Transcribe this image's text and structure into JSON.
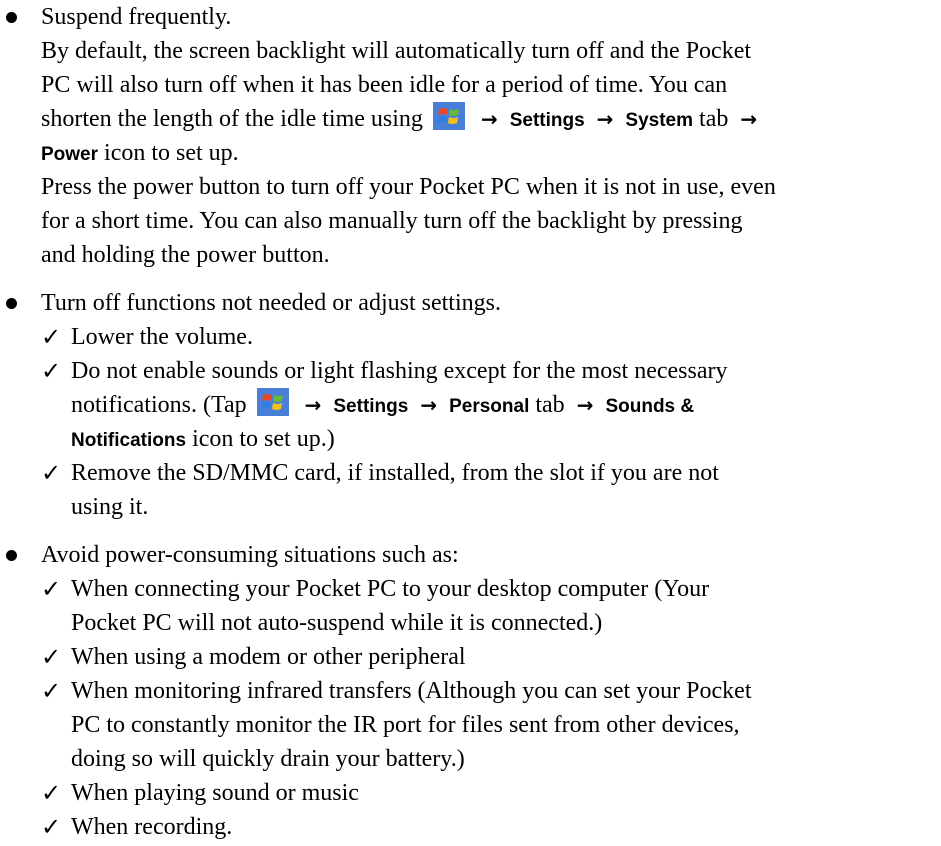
{
  "bullets": [
    {
      "heading": "Suspend frequently.",
      "para1": [
        "By default, the screen backlight will automatically turn off and the Pocket",
        "PC will also turn off when it has been idle for a period of time. You can"
      ],
      "para1_line3_prefix": "shorten the length of the idle time using",
      "para1_settings": "Settings",
      "para1_system": "System",
      "para1_tab": "tab",
      "para1_power": "Power",
      "para1_power_suffix": "icon to set up.",
      "para2": [
        "Press the power button to turn off your Pocket PC when it is not in use, even",
        "for a short time. You can also manually turn off the backlight by pressing",
        "and holding the power button."
      ]
    },
    {
      "heading": "Turn off functions not needed or adjust settings.",
      "items": {
        "volume": "Lower the volume.",
        "sounds_line1": "Do not enable sounds or light flashing except for the most necessary",
        "sounds_line2_prefix": "notifications. (Tap",
        "sounds_settings": "Settings",
        "sounds_personal": "Personal",
        "sounds_tab": "tab",
        "sounds_sounds": "Sounds &",
        "sounds_notifications": "Notifications",
        "sounds_suffix": "icon to set up.)",
        "sd_line1": "Remove the SD/MMC card, if installed, from the slot if you are not",
        "sd_line2": "using it."
      }
    },
    {
      "heading": "Avoid power-consuming situations such as:",
      "items": [
        {
          "lines": [
            "When connecting your Pocket PC to your desktop computer (Your",
            "Pocket PC will not auto-suspend while it is connected.)"
          ]
        },
        {
          "lines": [
            "When using a modem or other peripheral"
          ]
        },
        {
          "lines": [
            "When monitoring infrared transfers (Although you can set your Pocket",
            "PC to constantly monitor the IR port for files sent from other devices,",
            "doing so will quickly drain your battery.)"
          ]
        },
        {
          "lines": [
            "When playing sound or music"
          ]
        },
        {
          "lines": [
            "When recording."
          ]
        }
      ]
    }
  ],
  "symbols": {
    "arrow": "→",
    "check": "✓"
  },
  "icons": {
    "start": "windows-start-icon"
  }
}
